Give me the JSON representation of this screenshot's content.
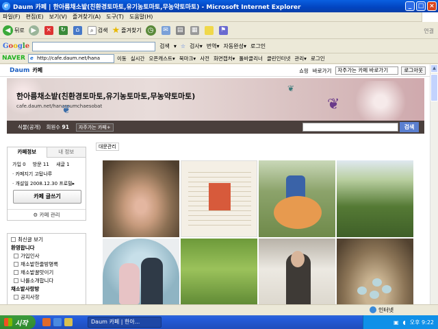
{
  "window": {
    "title": "Daum 카페 | 한아름채소밭(친환경토마토,유기농토마토,무농약토마토) - Microsoft Internet Explorer"
  },
  "menu": [
    "파일(F)",
    "편집(E)",
    "보기(V)",
    "즐겨찾기(A)",
    "도구(T)",
    "도움말(H)"
  ],
  "toolbar": {
    "back": "뒤로",
    "search": "검색",
    "favorites": "즐겨찾기",
    "links": "연결"
  },
  "google": {
    "logo": "Google",
    "search": "검색",
    "items": [
      "▾",
      "검사▾",
      "번역▾",
      "자동완성▾",
      "로그인"
    ]
  },
  "naver": {
    "logo": "NAVER",
    "address": "http://cafe.daum.net/hana",
    "go": "이동",
    "items": [
      "실시간",
      "오픈캐스트▾",
      "북마크▾",
      "사전",
      "화면캡처▾",
      "툴바클리너",
      "클린인터넷",
      "관리▾",
      "로그인"
    ]
  },
  "daum": {
    "logo": "Daum",
    "cafe": "카페",
    "shop": "쇼핑",
    "go": "바로가기",
    "select": "자주가는 카페 바로가기",
    "login": "로그아웃"
  },
  "banner": {
    "title": "한아름채소밭(친환경토마토,유기농토마토,무농약토마토)",
    "url": "cafe.daum.net/hanareumchaesobat"
  },
  "cafebar": {
    "grade": "식물(공개)",
    "members_label": "회원수",
    "members": "91",
    "fav": "자주가는 카페+",
    "search": "검색"
  },
  "leftbox": {
    "tab1": "카페정보",
    "tab2": "내 정보",
    "stat1": "가입 0",
    "stat2": "방문 11",
    "stat3": "새글 1",
    "info1": "· 카페지기  고탑나루",
    "info2": "· 개설일    2008.12.30  프로필▸",
    "write": "카페 글쓰기",
    "manage": "카페 관리"
  },
  "leftmenu": [
    "최신글 보기",
    "환영합니다",
    "가입인사",
    "채소밭한줄방명록",
    "채소밭꿀맛이기",
    "나를소개합니다",
    "채소밭사랑방",
    "공지사항"
  ],
  "rd_tab": "대문관리",
  "status": {
    "zone": "인터넷"
  },
  "taskbar": {
    "start": "시작",
    "task": "Daum 카페 | 한아...",
    "time": "오후 9:22"
  }
}
